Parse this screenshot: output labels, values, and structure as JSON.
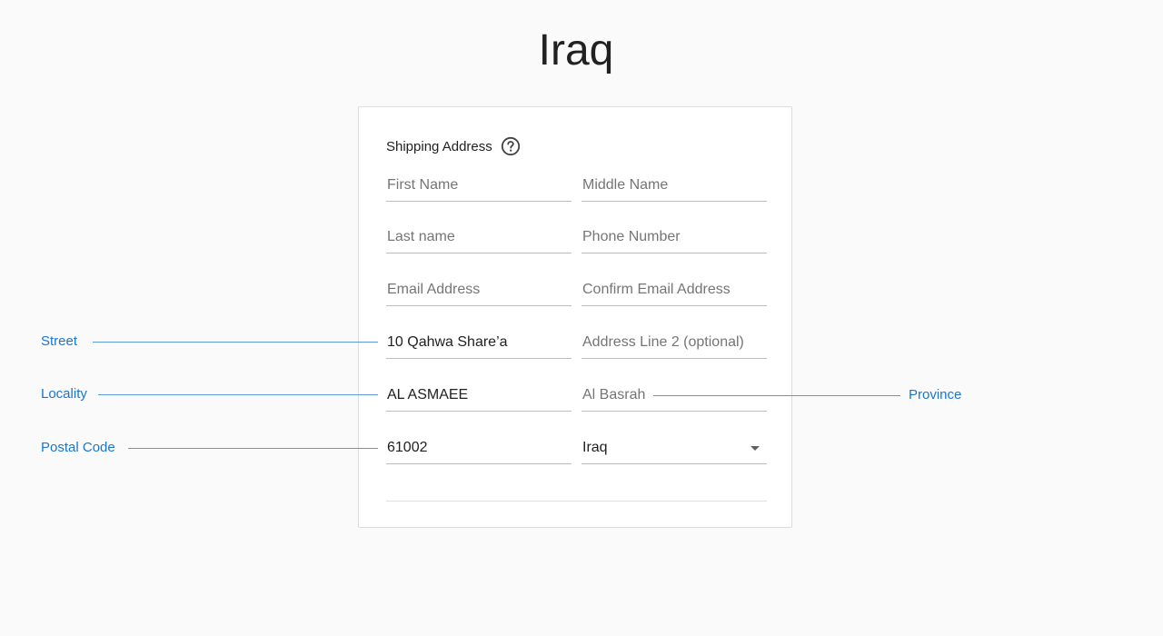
{
  "page": {
    "title": "Iraq"
  },
  "form": {
    "section_title": "Shipping Address",
    "help_icon": "help-circle-icon",
    "fields": {
      "first_name": {
        "placeholder": "First Name",
        "value": ""
      },
      "middle_name": {
        "placeholder": "Middle Name",
        "value": ""
      },
      "last_name": {
        "placeholder": "Last name",
        "value": ""
      },
      "phone_number": {
        "placeholder": "Phone Number",
        "value": ""
      },
      "email": {
        "placeholder": "Email Address",
        "value": ""
      },
      "confirm_email": {
        "placeholder": "Confirm Email Address",
        "value": ""
      },
      "street": {
        "placeholder": "",
        "value": "10 Qahwa Share’a"
      },
      "address_line_2": {
        "placeholder": "Address Line 2 (optional)",
        "value": ""
      },
      "locality": {
        "placeholder": "",
        "value": "AL ASMAEE"
      },
      "province": {
        "placeholder": "Al Basrah",
        "value": ""
      },
      "postal_code": {
        "placeholder": "",
        "value": "61002"
      },
      "country": {
        "selected": "Iraq",
        "icon": "dropdown-arrow-icon"
      }
    }
  },
  "annotations": {
    "street": "Street",
    "locality": "Locality",
    "postal_code": "Postal Code",
    "province": "Province"
  },
  "colors": {
    "accent": "#1976d2",
    "annotation_line": "#5b9bd5",
    "background": "#fafafa",
    "card": "#ffffff"
  }
}
